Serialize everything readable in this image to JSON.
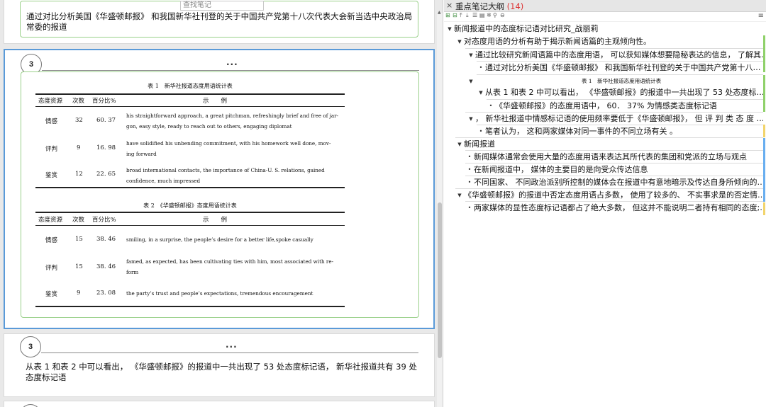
{
  "search": {
    "placeholder": "查找笔记"
  },
  "cards": [
    {
      "text": "通过对比分析美国《华盛顿邮报》 和我国新华社刊登的关于中国共产党第十八次代表大会新当选中央政治局常委的报道"
    },
    {
      "number": "3",
      "ellipsis": "...",
      "table1": {
        "caption": "表 1　新华社报道态度用语统计表",
        "headers": [
          "态度资源",
          "次数",
          "百分比%",
          "示　　例"
        ],
        "rows": [
          [
            "情感",
            "32",
            "60. 37",
            "his straightforward approach, a great pitchman, refreshingly brief and free of jar-",
            "gon, easy style, ready to reach out to others, engaging diplomat"
          ],
          [
            "评判",
            "9",
            "16. 98",
            "have solidified his unbending commitment, with his homework well done, mov-",
            "ing forward"
          ],
          [
            "鉴赏",
            "12",
            "22. 65",
            "broad international contacts, the importance of China-U. S. relations, gained",
            "confidence, much impressed"
          ]
        ]
      },
      "table2": {
        "caption": "表 2　《华盛顿邮报》态度用语统计表",
        "headers": [
          "态度资源",
          "次数",
          "百分比%",
          "示　　例"
        ],
        "rows": [
          [
            "情感",
            "15",
            "38. 46",
            "smiling, in a surprise, the people’s desire for a better life,spoke casually",
            ""
          ],
          [
            "评判",
            "15",
            "38. 46",
            "famed, as expected, has been cultivating ties with him, most associated with re-",
            "form"
          ],
          [
            "鉴赏",
            "9",
            "23. 08",
            "the party’s trust and people’s expectations, tremendous encouragement",
            ""
          ]
        ]
      }
    },
    {
      "number": "3",
      "ellipsis": "...",
      "text": "从表 1 和表 2 中可以看出， 《华盛顿邮报》的报道中一共出现了 53 处态度标记语， 新华社报道共有 39 处态度标记语"
    }
  ],
  "outline_panel": {
    "close": "×",
    "title": "重点笔记大纲",
    "count": "(14)",
    "menu": "≡",
    "toolbar_icons": [
      "expand-all-icon",
      "collapse-all-icon",
      "move-up-icon",
      "move-down-icon",
      "indent-icon",
      "outdent-icon",
      "star-icon",
      "search-icon",
      "lock-icon"
    ],
    "items": [
      {
        "level": 0,
        "marker": "arrow",
        "text": "新闻报道中的态度标记语对比研究_战丽莉"
      },
      {
        "level": 1,
        "marker": "arrow",
        "text": "对态度用语的分析有助于揭示新闻语篇的主观倾向性。"
      },
      {
        "level": 2,
        "marker": "arrow",
        "text": "通过比较研究新闻语篇中的态度用语， 可以获知媒体想要隐秘表达的信息， 了解其…"
      },
      {
        "level": 3,
        "marker": "dot",
        "text": "通过对比分析美国《华盛顿邮报》 和我国新华社刊登的关于中国共产党第十八…"
      },
      {
        "level": 2,
        "marker": "arrow",
        "text": "表 1　新华社报道态度用语统计表"
      },
      {
        "level": 2,
        "marker": "arrow",
        "text": "从表 1 和表 2 中可以看出， 《华盛顿邮报》的报道中一共出现了 53 处态度标…"
      },
      {
        "level": 3,
        "marker": "dot",
        "text": "《华盛顿邮报》的态度用语中， 60． 37% 为情感类态度标记语"
      },
      {
        "level": 2,
        "marker": "arrow",
        "text": "， 新华社报道中情感标记语的使用频率要低于《华盛顿邮报》， 但 评 判 类 态 度 …"
      },
      {
        "level": 3,
        "marker": "dot",
        "text": "笔者认为， 这和两家媒体对同一事件的不同立场有关 。"
      },
      {
        "level": 1,
        "marker": "arrow",
        "text": "新闻报道"
      },
      {
        "level": 2,
        "marker": "dot",
        "text": "新闻媒体通常会使用大量的态度用语来表达其所代表的集团和党派的立场与观点"
      },
      {
        "level": 2,
        "marker": "dot",
        "text": "在新闻报道中， 媒体的主要目的是向受众传达信息"
      },
      {
        "level": 2,
        "marker": "dot",
        "text": "不同国家、 不同政治派别所控制的媒体会在报道中有意地暗示及传达自身所倾向的…"
      },
      {
        "level": 1,
        "marker": "arrow",
        "text": "《华盛顿邮报》的报道中否定态度用语占多数， 使用了较多的、 不实事求是的否定情…"
      },
      {
        "level": 2,
        "marker": "dot",
        "text": "两家媒体的显性态度标记语都占了绝大多数， 但这并不能说明二者持有相同的态度;…"
      }
    ],
    "bar_colors": {
      "green": "#8fd16a",
      "blue": "#68aef0",
      "yellow": "#f2d46b"
    }
  }
}
